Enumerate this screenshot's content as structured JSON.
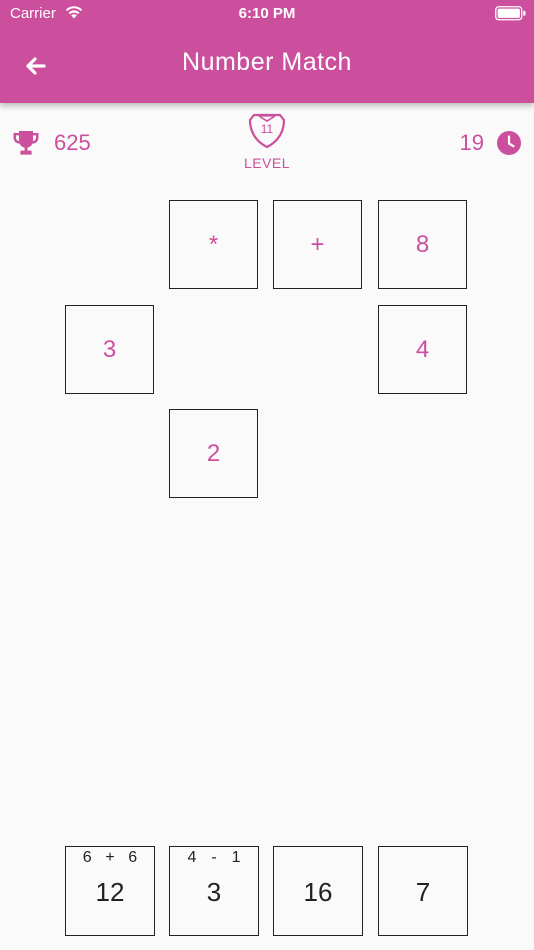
{
  "status_bar": {
    "carrier": "Carrier",
    "time": "6:10 PM"
  },
  "app_bar": {
    "title": "Number Match",
    "back_icon": "arrow-left-icon"
  },
  "stats": {
    "score": "625",
    "score_icon": "trophy-icon",
    "level_number": "11",
    "level_label": "LEVEL",
    "level_icon": "shield-icon",
    "timer": "19",
    "timer_icon": "clock-icon"
  },
  "board": {
    "row1": [
      "*",
      "+",
      "8"
    ],
    "row2": [
      "3",
      "4"
    ],
    "row3": [
      "2"
    ]
  },
  "tiles": [
    {
      "expr": [
        "6",
        "+",
        "6"
      ],
      "value": "12"
    },
    {
      "expr": [
        "4",
        "-",
        "1"
      ],
      "value": "3"
    },
    {
      "expr": [],
      "value": "16"
    },
    {
      "expr": [],
      "value": "7"
    }
  ],
  "colors": {
    "primary": "#cc4f9d",
    "background": "#fafafa",
    "border": "#222222"
  }
}
